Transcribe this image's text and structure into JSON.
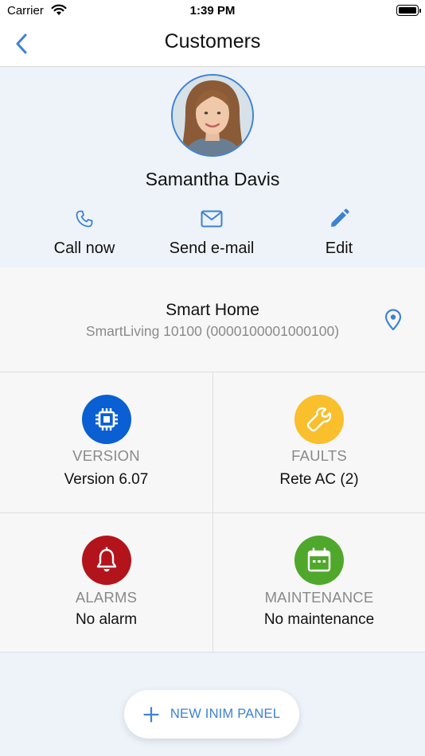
{
  "status_bar": {
    "carrier": "Carrier",
    "time": "1:39 PM"
  },
  "nav": {
    "title": "Customers"
  },
  "customer": {
    "name": "Samantha Davis",
    "actions": [
      {
        "label": "Call now",
        "icon": "phone-icon"
      },
      {
        "label": "Send e-mail",
        "icon": "mail-icon"
      },
      {
        "label": "Edit",
        "icon": "pencil-icon"
      }
    ]
  },
  "site": {
    "name": "Smart Home",
    "device": "SmartLiving 10100 (0000100001000100)"
  },
  "tiles": [
    {
      "label": "VERSION",
      "value": "Version 6.07",
      "icon": "chip-icon",
      "color": "#0a5fd3"
    },
    {
      "label": "FAULTS",
      "value": "Rete AC (2)",
      "icon": "wrench-icon",
      "color": "#f9bf2c"
    },
    {
      "label": "ALARMS",
      "value": "No alarm",
      "icon": "bell-icon",
      "color": "#b3141c"
    },
    {
      "label": "MAINTENANCE",
      "value": "No maintenance",
      "icon": "calendar-icon",
      "color": "#4fa82b"
    }
  ],
  "fab": {
    "label": "NEW INIM PANEL"
  },
  "colors": {
    "accent": "#3c82d4",
    "secondary_text": "#8a8a8a",
    "background": "#eef3fa"
  }
}
